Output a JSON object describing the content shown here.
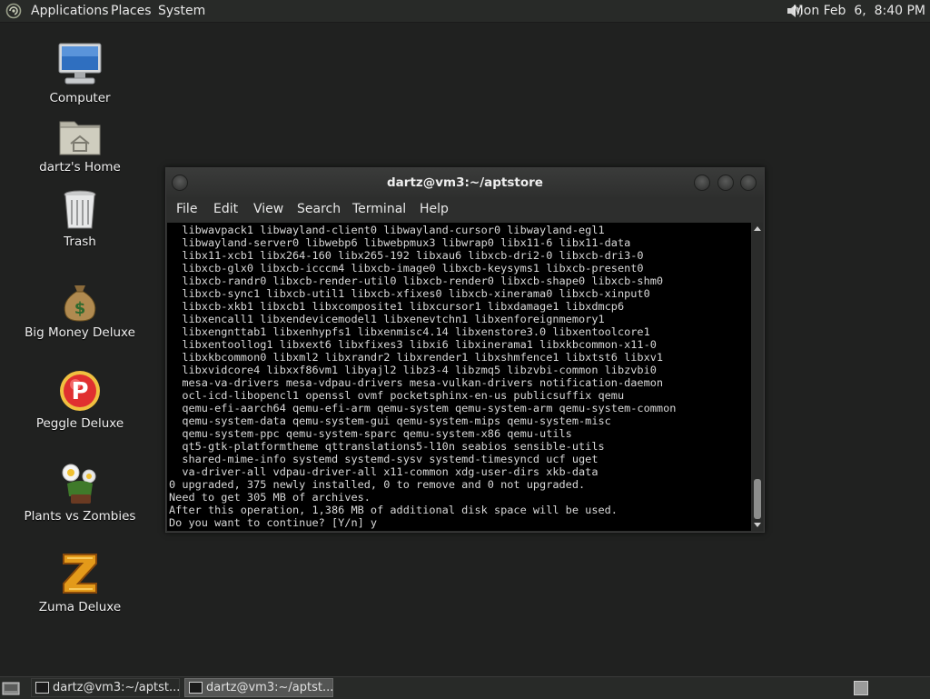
{
  "top_panel": {
    "menus": [
      "Applications",
      "Places",
      "System"
    ],
    "clock": "Mon Feb  6,  8:40 PM",
    "distro_icon": "distro-logo-icon",
    "volume_icon": "speaker-volume-icon"
  },
  "desktop": {
    "icons": [
      {
        "label": "Computer",
        "icon": "computer-icon"
      },
      {
        "label": "dartz's Home",
        "icon": "home-folder-icon"
      },
      {
        "label": "Trash",
        "icon": "trash-icon"
      },
      {
        "label": "Big Money Deluxe",
        "icon": "money-bag-icon"
      },
      {
        "label": "Peggle Deluxe",
        "icon": "peggle-icon"
      },
      {
        "label": "Plants vs Zombies",
        "icon": "plants-vs-zombies-icon"
      },
      {
        "label": "Zuma Deluxe",
        "icon": "zuma-icon"
      }
    ]
  },
  "terminal": {
    "title": "dartz@vm3:~/aptstore",
    "menus": [
      "File",
      "Edit",
      "View",
      "Search",
      "Terminal",
      "Help"
    ],
    "lines": [
      "  libwavpack1 libwayland-client0 libwayland-cursor0 libwayland-egl1",
      "  libwayland-server0 libwebp6 libwebpmux3 libwrap0 libx11-6 libx11-data",
      "  libx11-xcb1 libx264-160 libx265-192 libxau6 libxcb-dri2-0 libxcb-dri3-0",
      "  libxcb-glx0 libxcb-icccm4 libxcb-image0 libxcb-keysyms1 libxcb-present0",
      "  libxcb-randr0 libxcb-render-util0 libxcb-render0 libxcb-shape0 libxcb-shm0",
      "  libxcb-sync1 libxcb-util1 libxcb-xfixes0 libxcb-xinerama0 libxcb-xinput0",
      "  libxcb-xkb1 libxcb1 libxcomposite1 libxcursor1 libxdamage1 libxdmcp6",
      "  libxencall1 libxendevicemodel1 libxenevtchn1 libxenforeignmemory1",
      "  libxengnttab1 libxenhypfs1 libxenmisc4.14 libxenstore3.0 libxentoolcore1",
      "  libxentoollog1 libxext6 libxfixes3 libxi6 libxinerama1 libxkbcommon-x11-0",
      "  libxkbcommon0 libxml2 libxrandr2 libxrender1 libxshmfence1 libxtst6 libxv1",
      "  libxvidcore4 libxxf86vm1 libyajl2 libz3-4 libzmq5 libzvbi-common libzvbi0",
      "  mesa-va-drivers mesa-vdpau-drivers mesa-vulkan-drivers notification-daemon",
      "  ocl-icd-libopencl1 openssl ovmf pocketsphinx-en-us publicsuffix qemu",
      "  qemu-efi-aarch64 qemu-efi-arm qemu-system qemu-system-arm qemu-system-common",
      "  qemu-system-data qemu-system-gui qemu-system-mips qemu-system-misc",
      "  qemu-system-ppc qemu-system-sparc qemu-system-x86 qemu-utils",
      "  qt5-gtk-platformtheme qttranslations5-l10n seabios sensible-utils",
      "  shared-mime-info systemd systemd-sysv systemd-timesyncd ucf uget",
      "  va-driver-all vdpau-driver-all x11-common xdg-user-dirs xkb-data",
      "0 upgraded, 375 newly installed, 0 to remove and 0 not upgraded.",
      "Need to get 305 MB of archives.",
      "After this operation, 1,386 MB of additional disk space will be used.",
      "Do you want to continue? [Y/n] y"
    ]
  },
  "taskbar": {
    "tasks": [
      {
        "label": "dartz@vm3:~/aptst...",
        "active": false
      },
      {
        "label": "dartz@vm3:~/aptst...",
        "active": true
      }
    ],
    "show_desktop_icon": "show-desktop-icon",
    "workspace_icon": "workspace-switcher-icon"
  },
  "colors": {
    "desktop_bg": "#202120",
    "panel_bg": "#282a28",
    "terminal_bg": "#000000",
    "terminal_fg": "#d8d8d8"
  }
}
